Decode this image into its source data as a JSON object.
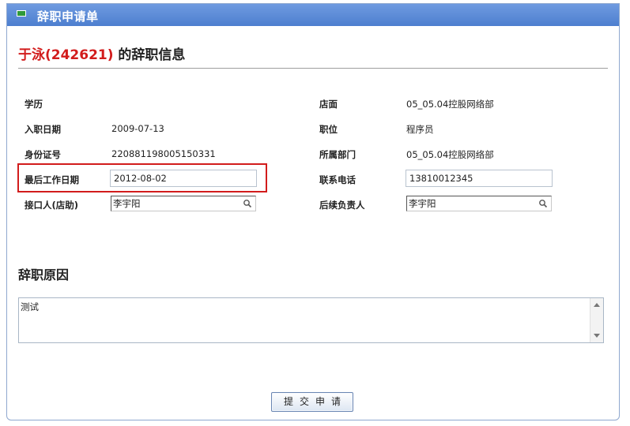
{
  "window": {
    "title": "辞职申请单"
  },
  "heading": {
    "name": "于泳(242621)",
    "suffix": " 的辞职信息"
  },
  "fields": {
    "education_label": "学历",
    "education_value": "",
    "hire_date_label": "入职日期",
    "hire_date_value": "2009-07-13",
    "id_card_label": "身份证号",
    "id_card_value": "220881198005150331",
    "last_work_date_label": "最后工作日期",
    "last_work_date_value": "2012-08-02",
    "handover_label": "接口人(店助)",
    "handover_value": "李宇阳",
    "store_label": "店面",
    "store_value": "05_05.04控股网络部",
    "position_label": "职位",
    "position_value": "程序员",
    "department_label": "所属部门",
    "department_value": "05_05.04控股网络部",
    "phone_label": "联系电话",
    "phone_value": "13810012345",
    "followup_label": "后续负责人",
    "followup_value": "李宇阳"
  },
  "reason": {
    "title": "辞职原因",
    "text": "测试"
  },
  "actions": {
    "submit_label": "提交申请"
  },
  "colors": {
    "titlebar": "#5a8ad6",
    "highlight": "#d21c1c",
    "name": "#d21c1c"
  }
}
